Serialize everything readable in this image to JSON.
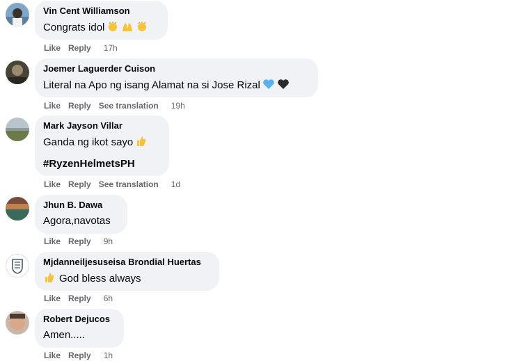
{
  "comments": [
    {
      "author": "Vin Cent Williamson",
      "text": "Congrats idol",
      "like": "Like",
      "reply": "Reply",
      "time": "17h"
    },
    {
      "author": "Joemer Laguerder Cuison",
      "text": "Literal na Apo ng isang Alamat na si Jose Rizal",
      "like": "Like",
      "reply": "Reply",
      "translate": "See translation",
      "time": "19h"
    },
    {
      "author": "Mark Jayson Villar",
      "text": "Ganda ng ikot sayo",
      "hashtag": "#RyzenHelmetsPH",
      "like": "Like",
      "reply": "Reply",
      "translate": "See translation",
      "time": "1d"
    },
    {
      "author": "Jhun B. Dawa",
      "text": "Agora,navotas",
      "like": "Like",
      "reply": "Reply",
      "time": "9h"
    },
    {
      "author": "Mjdanneiljesuseisa Brondial Huertas",
      "text": "God bless always",
      "like": "Like",
      "reply": "Reply",
      "time": "6h"
    },
    {
      "author": "Robert Dejucos",
      "text": "Amen.....",
      "like": "Like",
      "reply": "Reply",
      "time": "1h"
    }
  ],
  "icons": {
    "clap": "clapping-hands-icon",
    "raise": "raised-hands-icon",
    "blue_heart": "blue-heart-icon",
    "black_heart": "black-heart-icon",
    "thumbs_up": "thumbs-up-icon"
  },
  "colors": {
    "bubble": "#f0f2f5",
    "meta": "#65676b",
    "text": "#050505"
  }
}
